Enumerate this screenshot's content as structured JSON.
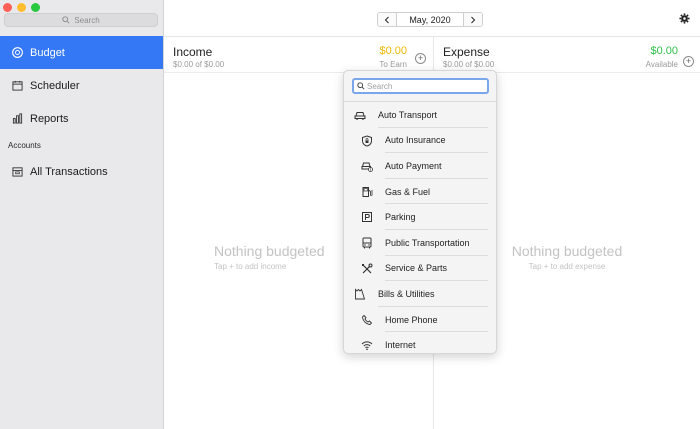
{
  "sidebar": {
    "search_placeholder": "Search",
    "items": [
      {
        "label": "Budget",
        "icon": "budget-icon",
        "active": true
      },
      {
        "label": "Scheduler",
        "icon": "calendar-icon",
        "active": false
      },
      {
        "label": "Reports",
        "icon": "chart-icon",
        "active": false
      }
    ],
    "accounts_label": "Accounts",
    "accounts_items": [
      {
        "label": "All Transactions",
        "icon": "inbox-icon"
      }
    ]
  },
  "toolbar": {
    "prev": "<",
    "month": "May, 2020",
    "next": ">"
  },
  "income": {
    "title": "Income",
    "subtitle": "$0.00 of $0.00",
    "amount": "$0.00",
    "amount_label": "To Earn",
    "empty_title": "Nothing budgeted",
    "empty_sub": "Tap + to add income"
  },
  "expense": {
    "title": "Expense",
    "subtitle": "$0.00 of $0.00",
    "amount": "$0.00",
    "amount_label": "Available",
    "empty_title": "Nothing budgeted",
    "empty_sub": "Tap + to add expense"
  },
  "category_popover": {
    "search_placeholder": "Search",
    "items": [
      {
        "label": "Auto Transport",
        "level": "parent",
        "icon": "car-icon"
      },
      {
        "label": "Auto Insurance",
        "level": "child",
        "icon": "shield-lock-icon"
      },
      {
        "label": "Auto Payment",
        "level": "child",
        "icon": "car-payment-icon"
      },
      {
        "label": "Gas & Fuel",
        "level": "child",
        "icon": "fuel-pump-icon"
      },
      {
        "label": "Parking",
        "level": "child",
        "icon": "parking-icon"
      },
      {
        "label": "Public Transportation",
        "level": "child",
        "icon": "bus-icon"
      },
      {
        "label": "Service & Parts",
        "level": "child",
        "icon": "tools-icon"
      },
      {
        "label": "Bills & Utilities",
        "level": "parent",
        "icon": "bill-icon"
      },
      {
        "label": "Home Phone",
        "level": "child",
        "icon": "phone-icon"
      },
      {
        "label": "Internet",
        "level": "child",
        "icon": "wifi-icon"
      }
    ]
  },
  "colors": {
    "accent": "#3478f6",
    "income_amount": "#f2b705",
    "expense_amount": "#2fbf4a"
  }
}
